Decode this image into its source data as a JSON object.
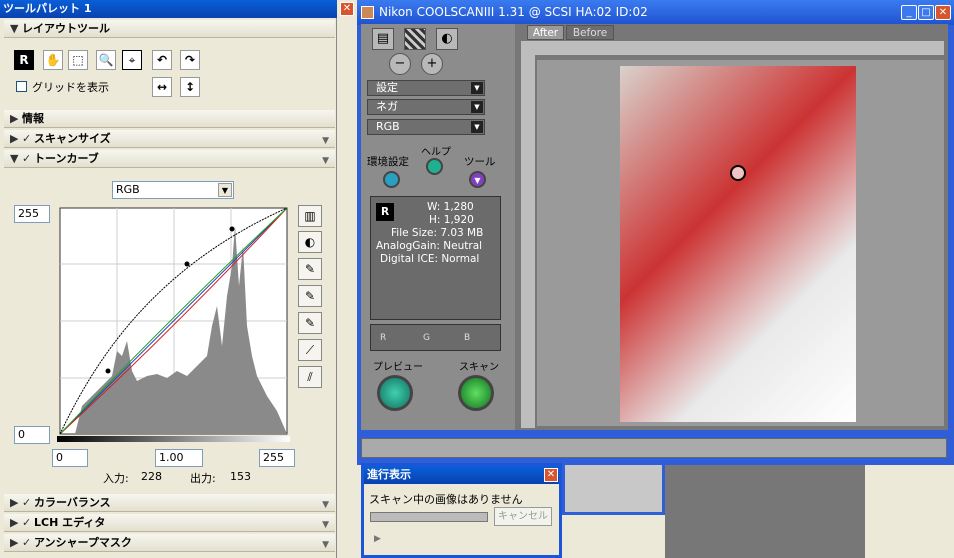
{
  "palette": {
    "title": "ツールパレット 1",
    "layout_tool": "レイアウトツール",
    "grid_label": "グリッドを表示",
    "info": "情報",
    "scan_size": "スキャンサイズ",
    "tone_curve": "トーンカーブ",
    "channel": "RGB",
    "out_max": "255",
    "out_min": "0",
    "in_black": "0",
    "in_gamma": "1.00",
    "in_white": "255",
    "input_label": "入力:",
    "input_value": "228",
    "output_label": "出力:",
    "output_value": "153",
    "color_balance": "カラーバランス",
    "lch_editor": "LCH エディタ",
    "unsharp_mask": "アンシャープマスク"
  },
  "nikon": {
    "title": "Nikon COOLSCANIII 1.31 @ SCSI HA:02 ID:02",
    "menu1": "設定",
    "menu2": "ネガ",
    "menu3": "RGB",
    "env": "環境設定",
    "help": "ヘルプ",
    "tool": "ツール",
    "info_w": "W: 1,280",
    "info_h": "H: 1,920",
    "info_size": "File Size: 7.03 MB",
    "info_gain": "AnalogGain: Neutral",
    "info_ice": "Digital ICE: Normal",
    "rgb_r": "R",
    "rgb_g": "G",
    "rgb_b": "B",
    "preview": "プレビュー",
    "scan": "スキャン",
    "tab_after": "After",
    "tab_before": "Before"
  },
  "progress": {
    "title": "進行表示",
    "message": "スキャン中の画像はありません",
    "cancel": "キャンセル"
  }
}
